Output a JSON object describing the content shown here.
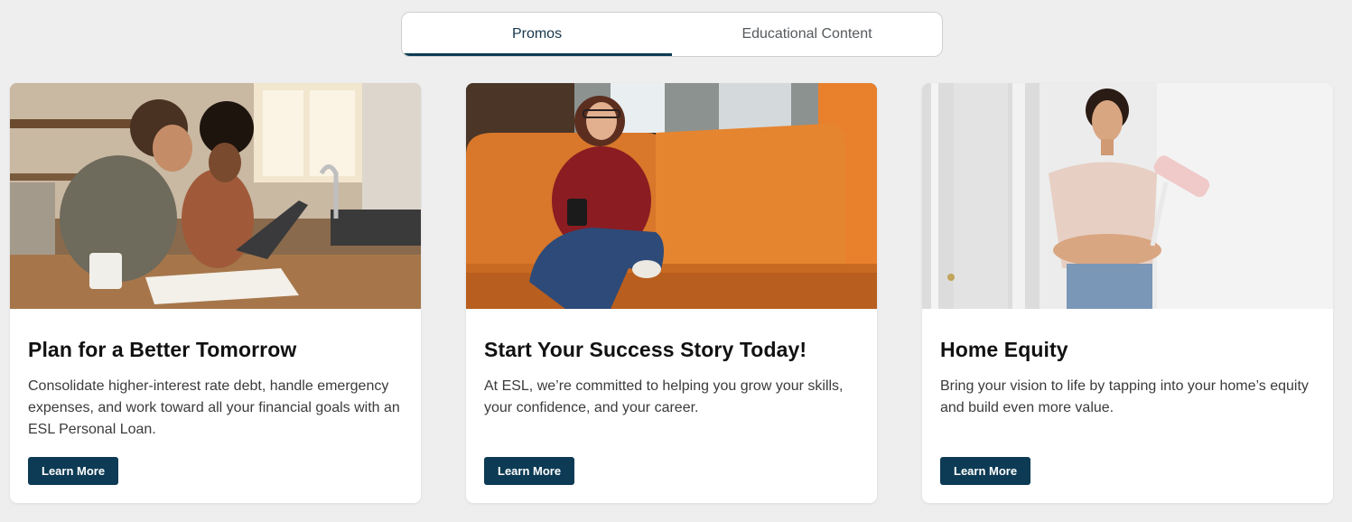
{
  "tabs": [
    {
      "label": "Promos",
      "active": true
    },
    {
      "label": "Educational Content",
      "active": false
    }
  ],
  "cards": [
    {
      "title": "Plan for a Better Tomorrow",
      "description": "Consolidate higher-interest rate debt, handle emergency expenses, and work toward all your financial goals with an ESL Personal Loan.",
      "button_label": "Learn More",
      "image_name": "couple-kitchen-laptop-photo"
    },
    {
      "title": "Start Your Success Story Today!",
      "description": "At ESL, we’re committed to helping you grow your skills, your confidence, and your career.",
      "button_label": "Learn More",
      "image_name": "woman-orange-couch-photo"
    },
    {
      "title": "Home Equity",
      "description": "Bring your vision to life by tapping into your home’s equity and build even more value.",
      "button_label": "Learn More",
      "image_name": "woman-paint-roller-photo"
    }
  ],
  "colors": {
    "background": "#eeeeee",
    "accent": "#0d3a54",
    "card": "#ffffff"
  }
}
